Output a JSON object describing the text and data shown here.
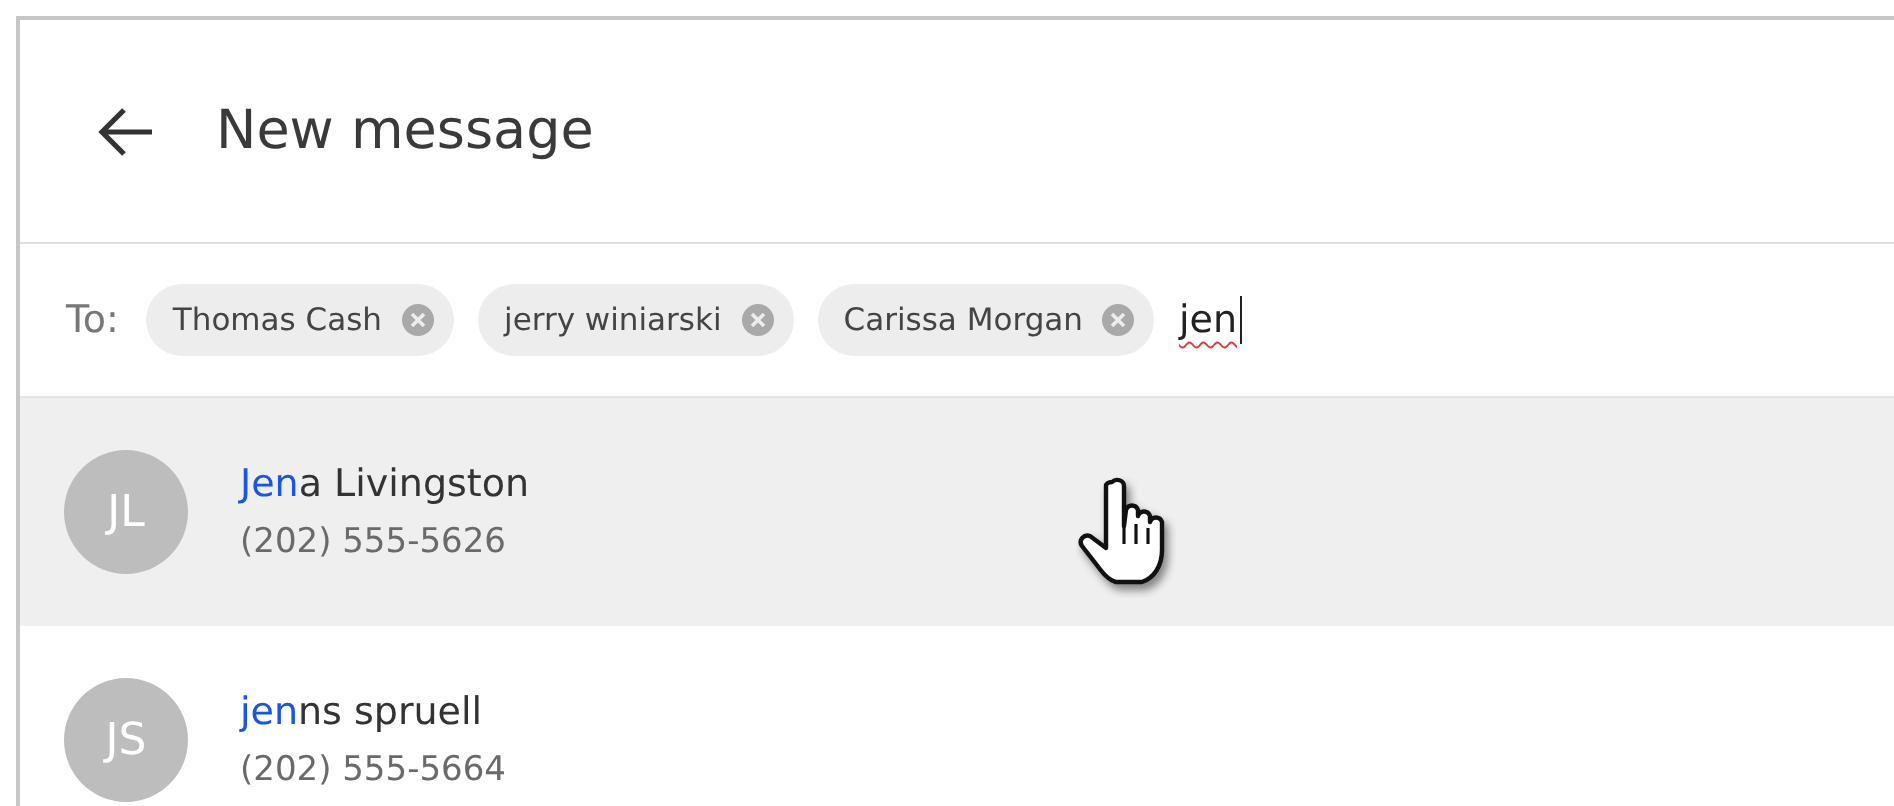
{
  "header": {
    "title": "New message"
  },
  "recipients": {
    "label": "To:",
    "chips": [
      {
        "name": "Thomas Cash"
      },
      {
        "name": "jerry winiarski"
      },
      {
        "name": "Carissa Morgan"
      }
    ],
    "value": "jen"
  },
  "suggestions": [
    {
      "initials": "JL",
      "name_match": "Jen",
      "name_rest": "a Livingston",
      "phone": "(202) 555-5626",
      "selected": true
    },
    {
      "initials": "JS",
      "name_match": "jen",
      "name_rest": "ns spruell",
      "phone": "(202) 555-5664",
      "selected": false
    }
  ]
}
